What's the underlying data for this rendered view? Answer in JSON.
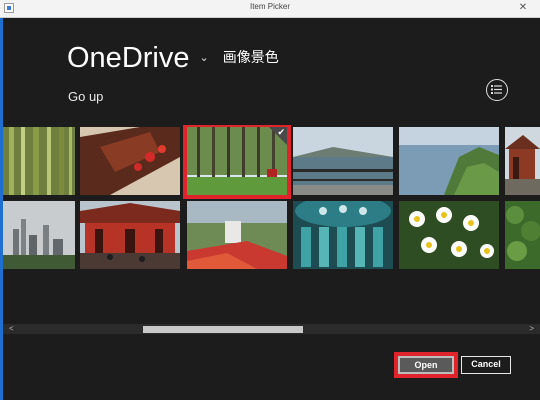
{
  "window": {
    "title": "Item Picker",
    "close_glyph": "✕"
  },
  "header": {
    "location": "OneDrive",
    "chevron": "⌄",
    "folder": "画像景色",
    "go_up": "Go up"
  },
  "icons": {
    "view": "list-view-icon",
    "check": "checkmark-icon"
  },
  "photos": [
    {
      "subject": "bamboo forest"
    },
    {
      "subject": "temple gate with lanterns"
    },
    {
      "subject": "trees on lawn",
      "selected": true
    },
    {
      "subject": "lake with railing"
    },
    {
      "subject": "coastal cliff"
    },
    {
      "subject": "pagoda"
    },
    {
      "subject": "city skyline"
    },
    {
      "subject": "red temple building"
    },
    {
      "subject": "garden with red flowers"
    },
    {
      "subject": "stained glass dome"
    },
    {
      "subject": "white daisies"
    },
    {
      "subject": "green foliage"
    }
  ],
  "buttons": {
    "open": "Open",
    "cancel": "Cancel"
  },
  "colors": {
    "selection": "#e0242b",
    "accent": "#1f6fd1",
    "background": "#1c1c1c"
  }
}
